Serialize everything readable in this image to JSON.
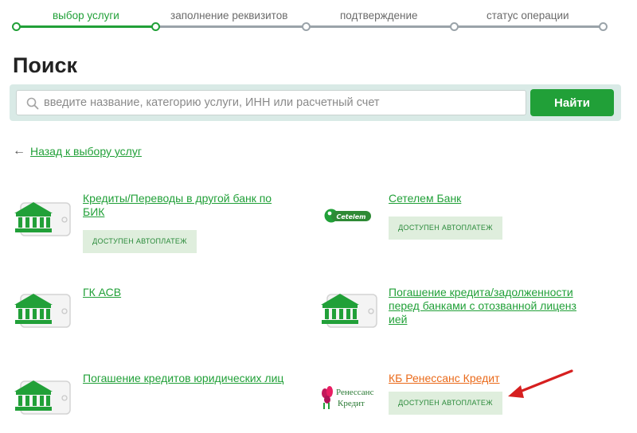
{
  "stepper": {
    "steps": [
      {
        "label": "выбор услуги",
        "state": "active"
      },
      {
        "label": "заполнение реквизитов",
        "state": "todo"
      },
      {
        "label": "подтверждение",
        "state": "todo"
      },
      {
        "label": "статус операции",
        "state": "todo"
      }
    ]
  },
  "page_title": "Поиск",
  "search": {
    "placeholder": "введите название, категорию услуги, ИНН или расчетный счет",
    "value": "",
    "button_label": "Найти"
  },
  "back_link": {
    "arrow": "←",
    "label": "Назад к выбору услуг"
  },
  "services": [
    {
      "title": "Кредиты/Переводы в другой банк по БИК",
      "icon": "bank-icon",
      "badge": "ДОСТУПЕН АВТОПЛАТЕЖ"
    },
    {
      "title": "Сетелем Банк",
      "icon": "cetelem-logo",
      "badge": "ДОСТУПЕН АВТОПЛАТЕЖ"
    },
    {
      "title": "ГК АСВ",
      "icon": "bank-icon",
      "badge": ""
    },
    {
      "title": "Погашение кредита/задолженности перед банками с отозванной лиценз ией",
      "icon": "bank-icon",
      "badge": ""
    },
    {
      "title": "Погашение кредитов юридических лиц",
      "icon": "bank-icon",
      "badge": ""
    },
    {
      "title": "КБ Ренессанс Кредит",
      "icon": "renaissance-logo",
      "badge": "ДОСТУПЕН АВТОПЛАТЕЖ",
      "highlight": true
    }
  ],
  "logos": {
    "cetelem_text": "Cetelem",
    "renaissance_line1": "Ренессанс",
    "renaissance_line2": "Кредит"
  },
  "colors": {
    "accent_green": "#21a038",
    "badge_bg": "#dfeedd",
    "highlight_orange": "#ea6a1a",
    "annotation_red": "#d61f1f"
  }
}
